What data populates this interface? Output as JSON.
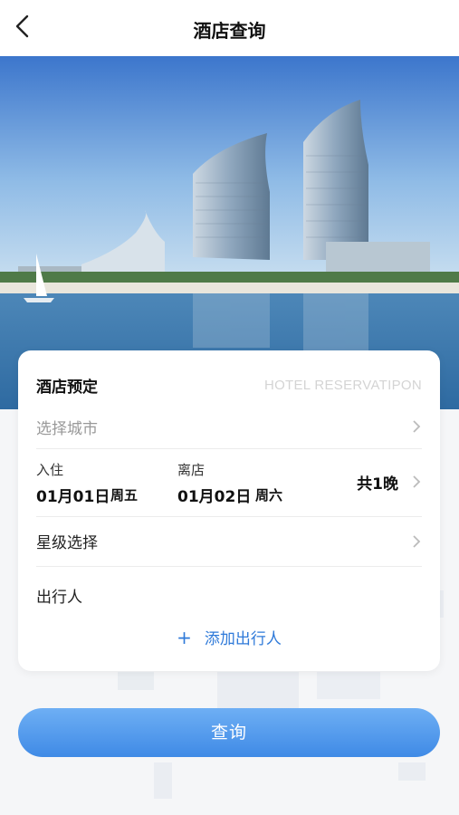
{
  "header": {
    "title": "酒店查询"
  },
  "card": {
    "title": "酒店预定",
    "subtitle": "HOTEL RESERVATIPON",
    "city_placeholder": "选择城市",
    "checkin": {
      "label": "入住",
      "date": "01月01日",
      "weekday": "周五"
    },
    "checkout": {
      "label": "离店",
      "date": "01月02日",
      "weekday": "周六"
    },
    "nights": "共1晚",
    "star_label": "星级选择",
    "traveler_label": "出行人",
    "add_traveler": "添加出行人"
  },
  "query_button": "查询",
  "colors": {
    "accent": "#3f8ae6",
    "link": "#2f7ad9"
  }
}
